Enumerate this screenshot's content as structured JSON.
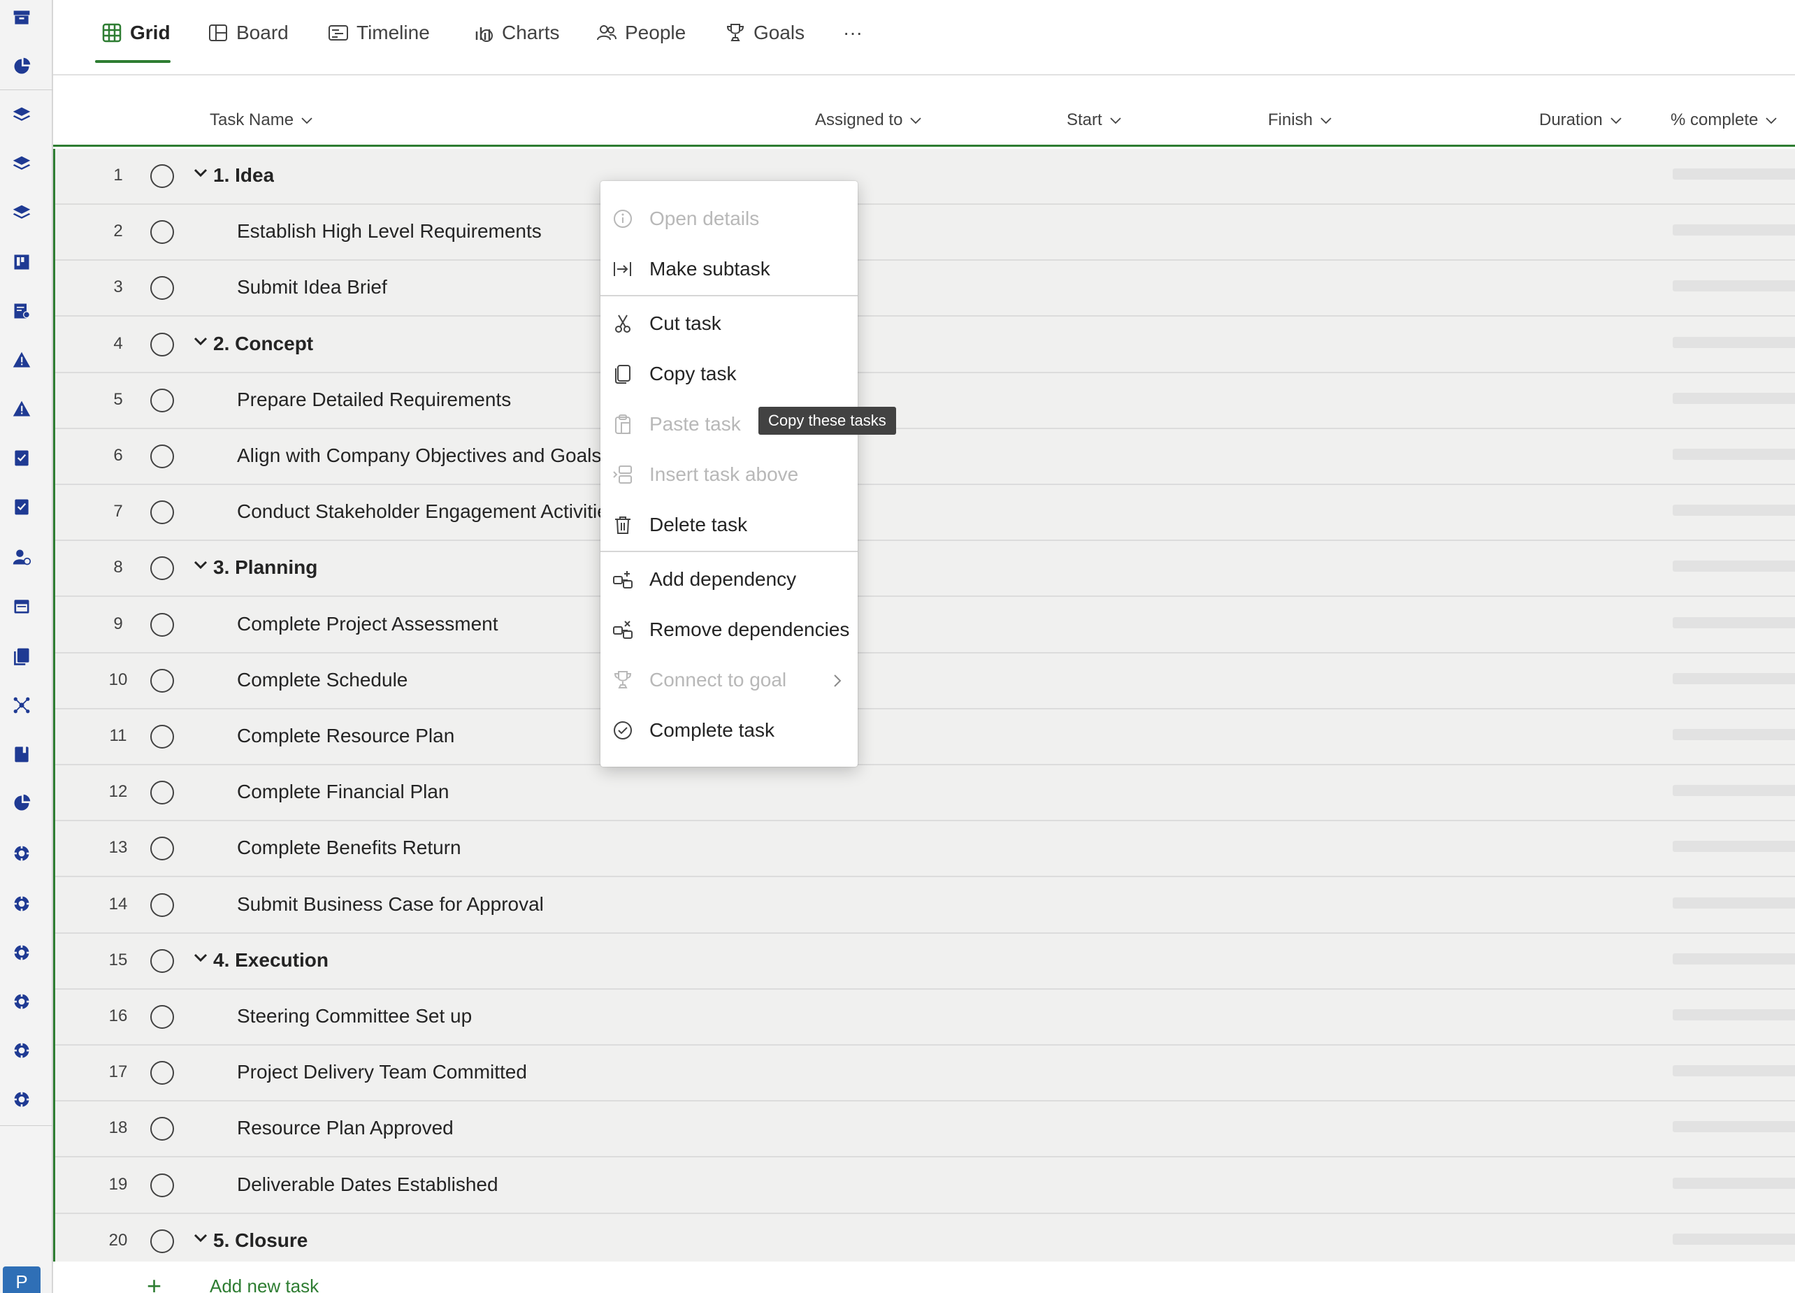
{
  "tabs": [
    {
      "label": "Grid",
      "icon": "grid-icon",
      "active": true
    },
    {
      "label": "Board",
      "icon": "board-icon",
      "active": false
    },
    {
      "label": "Timeline",
      "icon": "timeline-icon",
      "active": false
    },
    {
      "label": "Charts",
      "icon": "charts-icon",
      "active": false
    },
    {
      "label": "People",
      "icon": "people-icon",
      "active": false
    },
    {
      "label": "Goals",
      "icon": "trophy-icon",
      "active": false
    }
  ],
  "more_tabs_label": "···",
  "columns": {
    "task_name": "Task Name",
    "assigned_to": "Assigned to",
    "start": "Start",
    "finish": "Finish",
    "duration": "Duration",
    "percent_complete": "% complete"
  },
  "tasks": [
    {
      "num": "1",
      "name": "1. Idea",
      "summary": true
    },
    {
      "num": "2",
      "name": "Establish High Level Requirements",
      "summary": false
    },
    {
      "num": "3",
      "name": "Submit Idea Brief",
      "summary": false
    },
    {
      "num": "4",
      "name": "2. Concept",
      "summary": true
    },
    {
      "num": "5",
      "name": "Prepare Detailed Requirements",
      "summary": false
    },
    {
      "num": "6",
      "name": "Align with Company Objectives and Goals",
      "summary": false
    },
    {
      "num": "7",
      "name": "Conduct Stakeholder Engagement Activitie",
      "summary": false
    },
    {
      "num": "8",
      "name": "3. Planning",
      "summary": true
    },
    {
      "num": "9",
      "name": "Complete Project Assessment",
      "summary": false
    },
    {
      "num": "10",
      "name": "Complete Schedule",
      "summary": false
    },
    {
      "num": "11",
      "name": "Complete Resource Plan",
      "summary": false
    },
    {
      "num": "12",
      "name": "Complete Financial Plan",
      "summary": false
    },
    {
      "num": "13",
      "name": "Complete Benefits Return",
      "summary": false
    },
    {
      "num": "14",
      "name": "Submit Business Case for Approval",
      "summary": false
    },
    {
      "num": "15",
      "name": "4. Execution",
      "summary": true
    },
    {
      "num": "16",
      "name": "Steering Committee Set up",
      "summary": false
    },
    {
      "num": "17",
      "name": "Project Delivery Team Committed",
      "summary": false
    },
    {
      "num": "18",
      "name": "Resource Plan Approved",
      "summary": false
    },
    {
      "num": "19",
      "name": "Deliverable Dates Established",
      "summary": false
    },
    {
      "num": "20",
      "name": "5. Closure",
      "summary": true
    }
  ],
  "add_task_label": "Add new task",
  "context_menu": {
    "items": [
      {
        "label": "Open details",
        "icon": "info-icon",
        "disabled": true
      },
      {
        "label": "Make subtask",
        "icon": "indent-icon",
        "disabled": false
      },
      {
        "label": "Cut task",
        "icon": "scissors-icon",
        "disabled": false
      },
      {
        "label": "Copy task",
        "icon": "copy-icon",
        "disabled": false
      },
      {
        "label": "Paste task",
        "icon": "clipboard-icon",
        "disabled": true
      },
      {
        "label": "Insert task above",
        "icon": "insert-row-icon",
        "disabled": true
      },
      {
        "label": "Delete task",
        "icon": "trash-icon",
        "disabled": false
      },
      {
        "label": "Add dependency",
        "icon": "add-dependency-icon",
        "disabled": false
      },
      {
        "label": "Remove dependencies",
        "icon": "remove-dependency-icon",
        "disabled": false
      },
      {
        "label": "Connect to goal",
        "icon": "trophy-icon",
        "disabled": true,
        "submenu": true
      },
      {
        "label": "Complete task",
        "icon": "check-circle-icon",
        "disabled": false
      }
    ]
  },
  "tooltip": "Copy these tasks",
  "avatar_initial": "P",
  "colors": {
    "accent": "#2e7d32",
    "rail_icon": "#1f3a93",
    "grid_bg": "#f0f0ef",
    "disabled": "#b8b8b8"
  }
}
